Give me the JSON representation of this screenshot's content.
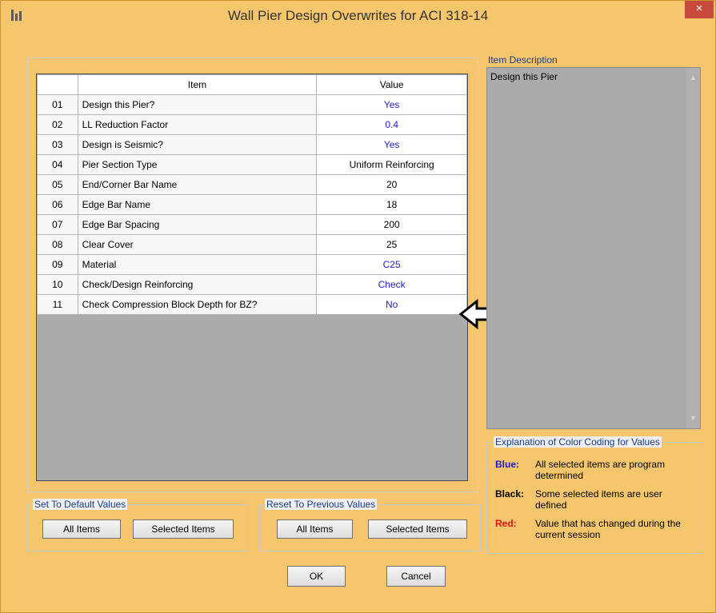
{
  "window": {
    "title": "Wall Pier Design Overwrites for ACI 318-14",
    "close_glyph": "×"
  },
  "table": {
    "headers": {
      "item": "Item",
      "value": "Value"
    },
    "rows": [
      {
        "num": "01",
        "item": "Design this Pier?",
        "value": "Yes",
        "color": "blue"
      },
      {
        "num": "02",
        "item": "LL Reduction Factor",
        "value": "0.4",
        "color": "blue"
      },
      {
        "num": "03",
        "item": "Design is Seismic?",
        "value": "Yes",
        "color": "blue"
      },
      {
        "num": "04",
        "item": "Pier Section Type",
        "value": "Uniform Reinforcing",
        "color": "black"
      },
      {
        "num": "05",
        "item": "End/Corner Bar Name",
        "value": "20",
        "color": "black"
      },
      {
        "num": "06",
        "item": "Edge Bar Name",
        "value": "18",
        "color": "black"
      },
      {
        "num": "07",
        "item": "Edge Bar Spacing",
        "value": "200",
        "color": "black"
      },
      {
        "num": "08",
        "item": "Clear Cover",
        "value": "25",
        "color": "black"
      },
      {
        "num": "09",
        "item": "Material",
        "value": "C25",
        "color": "blue"
      },
      {
        "num": "10",
        "item": "Check/Design Reinforcing",
        "value": "Check",
        "color": "blue"
      },
      {
        "num": "11",
        "item": "Check Compression Block Depth for BZ?",
        "value": "No",
        "color": "blue"
      }
    ]
  },
  "item_description": {
    "label": "Item Description",
    "text": "Design this Pier"
  },
  "color_coding": {
    "label": "Explanation of Color Coding for Values",
    "entries": [
      {
        "key": "Blue:",
        "text": "All selected items are program determined",
        "color": "#1a1ad0"
      },
      {
        "key": "Black:",
        "text": "Some selected items are user defined",
        "color": "#000000"
      },
      {
        "key": "Red:",
        "text": "Value that has changed during the current session",
        "color": "#e01010"
      }
    ]
  },
  "set_default": {
    "label": "Set To Default Values",
    "all_items": "All Items",
    "selected_items": "Selected Items"
  },
  "reset_previous": {
    "label": "Reset To Previous Values",
    "all_items": "All Items",
    "selected_items": "Selected Items"
  },
  "footer": {
    "ok": "OK",
    "cancel": "Cancel"
  },
  "colors": {
    "titlebar": "#f5c66b",
    "close": "#c74a3c",
    "blue_value": "#2020dc",
    "grid_empty": "#ababab"
  }
}
